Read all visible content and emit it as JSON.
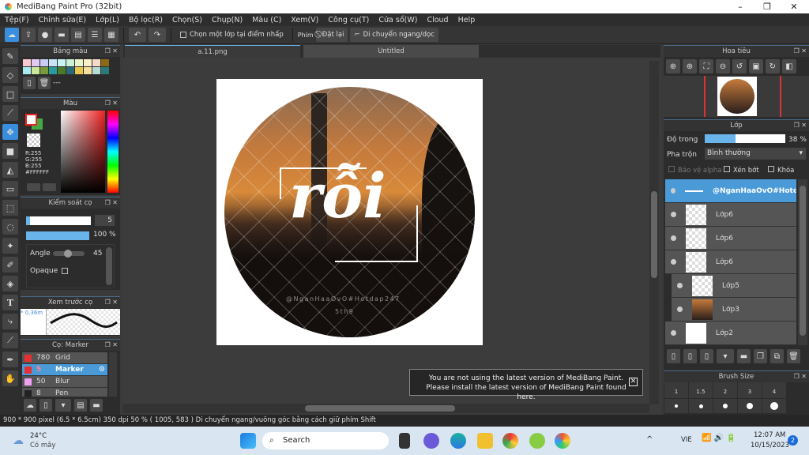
{
  "app": {
    "title": "MediBang Paint Pro (32bit)"
  },
  "menu": [
    "Tệp(F)",
    "Chỉnh sửa(E)",
    "Lớp(L)",
    "Bộ lọc(R)",
    "Chọn(S)",
    "Chụp(N)",
    "Màu (C)",
    "Xem(V)",
    "Công cụ(T)",
    "Cửa sổ(W)",
    "Cloud",
    "Help"
  ],
  "toolbar": {
    "select_layer": "Chọn một lớp tại điểm nhấp",
    "key_label": "Phím",
    "reset": "Đặt lại",
    "move_hv": "Di chuyển ngang/dọc"
  },
  "tabs": [
    "a.11.png",
    "Untitled"
  ],
  "palette": {
    "title": "Bảng màu",
    "colors": [
      "#f9c9cf",
      "#e2c9f2",
      "#c9ccf5",
      "#c9e4f9",
      "#c9f4f4",
      "#c9f2d9",
      "#e9f5c9",
      "#f9efc9",
      "#f5d9c9",
      "#8a6a14",
      "#a9eaf0",
      "#c9e89a",
      "#7a9a3a",
      "#2a9a9a",
      "#4a7a2a",
      "#2a6a7a",
      "#e8c84a",
      "#f5e0a0",
      "#b9dad5",
      "#2a7a7a"
    ],
    "label": "---"
  },
  "color": {
    "title": "Màu",
    "r": "R:255",
    "g": "G:255",
    "b": "B:255",
    "hex": "#FFFFFF",
    "fg": "#ffffff",
    "bg": "#44aa44"
  },
  "brush_control": {
    "title": "Kiểm soát cọ",
    "size": "5",
    "opacity": "100 %",
    "angle_label": "Angle",
    "angle": "45",
    "opaque_label": "Opaque"
  },
  "brush_preview": {
    "title": "Xem trước cọ",
    "size": "* 0.36m"
  },
  "brushes": {
    "title": "Cọ: Marker",
    "items": [
      {
        "size": "780",
        "name": "Grid",
        "color": "#e83030"
      },
      {
        "size": "5",
        "name": "Marker",
        "color": "#e83030",
        "selected": true
      },
      {
        "size": "50",
        "name": "Blur",
        "color": "#f0a0f0"
      },
      {
        "size": "8",
        "name": "Pen",
        "color": "#222222"
      }
    ]
  },
  "navigator": {
    "title": "Hoa tiêu"
  },
  "layers": {
    "title": "Lớp",
    "opacity_label": "Độ trong",
    "opacity": "38 %",
    "opacity_value": 38,
    "blend_label": "Pha trộn",
    "blend": "Bình thường",
    "protect_alpha": "Bảo vệ alpha",
    "clip": "Xén bớt",
    "lock": "Khóa",
    "items": [
      {
        "name": "@NganHaaOvO#Hotdap",
        "selected": true
      },
      {
        "name": "Lớp6"
      },
      {
        "name": "Lớp6"
      },
      {
        "name": "Lớp6"
      },
      {
        "name": "Lớp5",
        "indent": true
      },
      {
        "name": "Lớp3",
        "indent": true,
        "photo": true
      },
      {
        "name": "Lớp2",
        "white": true
      }
    ]
  },
  "brush_size": {
    "title": "Brush Size",
    "values": [
      "1",
      "1.5",
      "2",
      "3",
      "4"
    ]
  },
  "canvas": {
    "text": "rỗi",
    "watermark": "@NganHaaOvO#Hotdap247",
    "watermark2": "5th9"
  },
  "toast": {
    "line1": "You are not using the latest version of MediBang Paint.",
    "line2": "Please install the latest version of MediBang Paint found here."
  },
  "status": "900 * 900 pixel   (6.5 * 6.5cm)   350 dpi   50 %   ( 1005, 583 )   Di chuyển ngang/vuông góc bằng cách giữ phím Shift",
  "taskbar": {
    "temp": "24°C",
    "weather": "Có mây",
    "search": "Search",
    "lang": "VIE",
    "time": "12:07 AM",
    "date": "10/15/2023",
    "badge": "2"
  }
}
